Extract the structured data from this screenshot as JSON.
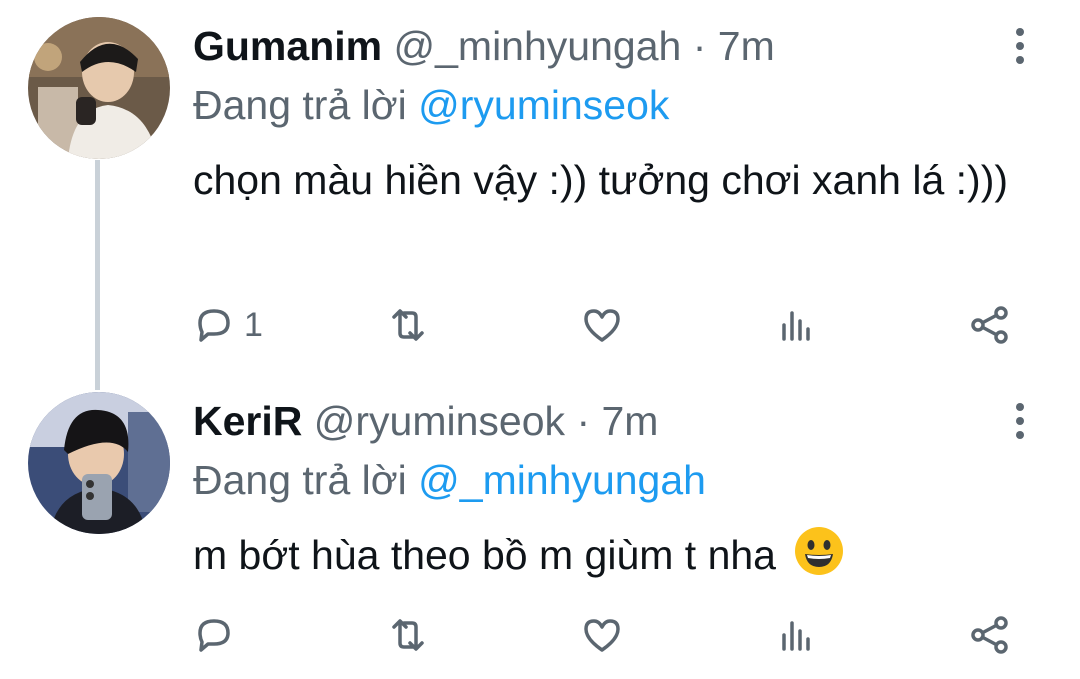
{
  "tweets": [
    {
      "name": "Gumanim",
      "handle": "@_minhyungah",
      "separator": "·",
      "time": "7m",
      "reply_prefix": "Đang trả lời",
      "reply_to": "@ryuminseok",
      "text": "chọn màu hiền vậy :)) tưởng chơi xanh lá :)))",
      "reply_count": "1"
    },
    {
      "name": "KeriR",
      "handle": "@ryuminseok",
      "separator": "·",
      "time": "7m",
      "reply_prefix": "Đang trả lời",
      "reply_to": "@_minhyungah",
      "text": "m bớt hùa theo bồ m giùm t nha",
      "reply_count": ""
    }
  ],
  "icons": {
    "reply": "reply-icon",
    "retweet": "retweet-icon",
    "like": "heart-icon",
    "analytics": "analytics-icon",
    "share": "share-icon",
    "more": "more-vertical-icon",
    "emoji": "grinning-face-emoji"
  },
  "colors": {
    "mention": "#1d9bf0",
    "secondary_text": "#5b6670",
    "thread_line": "#c9d1d8"
  }
}
